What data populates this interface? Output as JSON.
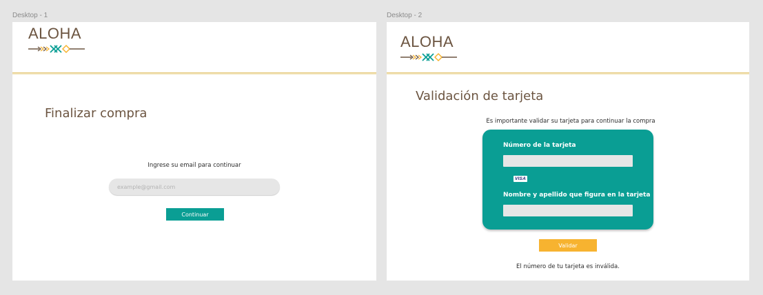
{
  "frames": [
    {
      "label": "Desktop - 1",
      "logo": {
        "text": "ALOHA"
      },
      "title": "Finalizar compra",
      "prompt": "Ingrese su email para continuar",
      "email_placeholder": "example@gmail.com",
      "continue_label": "Continuar"
    },
    {
      "label": "Desktop - 2",
      "logo": {
        "text": "ALOHA"
      },
      "title": "Validación de tarjeta",
      "subtitle": "Es importante validar su tarjeta para continuar la compra",
      "card": {
        "number_label": "Número de la tarjeta",
        "brand": "VISA",
        "name_label": "Nombre y apellido que figura en la tarjeta"
      },
      "validate_label": "Validar",
      "error_message": "El número de tu tarjeta es inválida."
    }
  ],
  "colors": {
    "brand_brown": "#6b5440",
    "teal": "#0a9e94",
    "yellow": "#f7b330",
    "rule": "#e6c87a"
  },
  "icons": [
    "aloha-arrow-icon",
    "visa-logo-icon"
  ]
}
